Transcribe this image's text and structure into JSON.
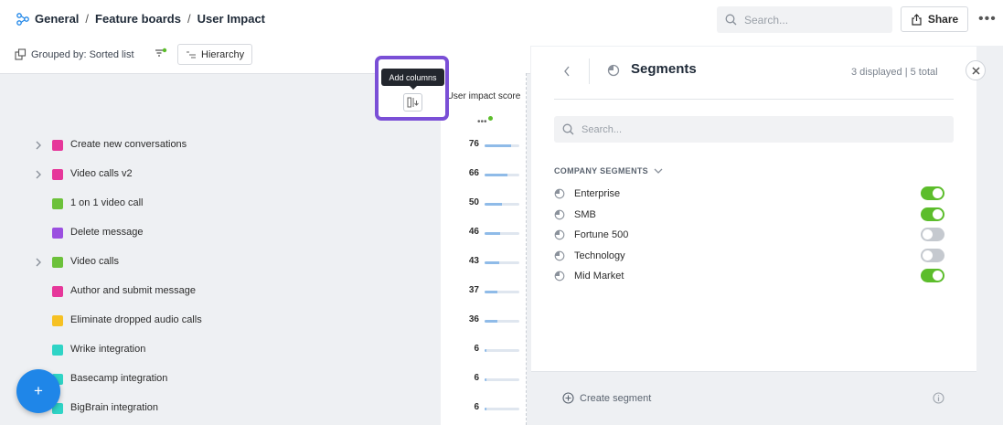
{
  "breadcrumb": {
    "items": [
      "General",
      "Feature boards",
      "User Impact"
    ],
    "separator": "/"
  },
  "header": {
    "search_placeholder": "Search...",
    "share_label": "Share",
    "more_label": "•••"
  },
  "toolbar": {
    "grouped_label": "Grouped by: Sorted list",
    "hierarchy_label": "Hierarchy"
  },
  "columns": {
    "score_header": "User impact score",
    "score_menu": "•••",
    "add_columns_tooltip": "Add columns"
  },
  "rows": [
    {
      "name": "Create new conversations",
      "score": "76",
      "color": "#e6379a",
      "expandable": true
    },
    {
      "name": "Video calls v2",
      "score": "66",
      "color": "#e6379a",
      "expandable": true
    },
    {
      "name": "1 on 1 video call",
      "score": "50",
      "color": "#6cc13a",
      "expandable": false
    },
    {
      "name": "Delete message",
      "score": "46",
      "color": "#9b4fe0",
      "expandable": false
    },
    {
      "name": "Video calls",
      "score": "43",
      "color": "#6cc13a",
      "expandable": true
    },
    {
      "name": "Author and submit message",
      "score": "37",
      "color": "#e6379a",
      "expandable": false
    },
    {
      "name": "Eliminate dropped audio calls",
      "score": "36",
      "color": "#f6c123",
      "expandable": false
    },
    {
      "name": "Wrike integration",
      "score": "6",
      "color": "#2fd4c6",
      "expandable": false
    },
    {
      "name": "Basecamp integration",
      "score": "6",
      "color": "#2fd4c6",
      "expandable": false
    },
    {
      "name": "BigBrain integration",
      "score": "6",
      "color": "#2fd4c6",
      "expandable": false
    }
  ],
  "fab": {
    "label": "+"
  },
  "panel": {
    "title": "Segments",
    "count": "3 displayed | 5 total",
    "search_placeholder": "Search...",
    "section_label": "COMPANY SEGMENTS",
    "segments": [
      {
        "name": "Enterprise",
        "enabled": true
      },
      {
        "name": "SMB",
        "enabled": true
      },
      {
        "name": "Fortune 500",
        "enabled": false
      },
      {
        "name": "Technology",
        "enabled": false
      },
      {
        "name": "Mid Market",
        "enabled": true
      }
    ],
    "create_label": "Create segment"
  },
  "colors": {
    "accent_purple": "#7a4fd6",
    "toggle_on": "#5cbd2b",
    "fab_blue": "#1f86e8",
    "score_bar": "#8fbbe8"
  }
}
